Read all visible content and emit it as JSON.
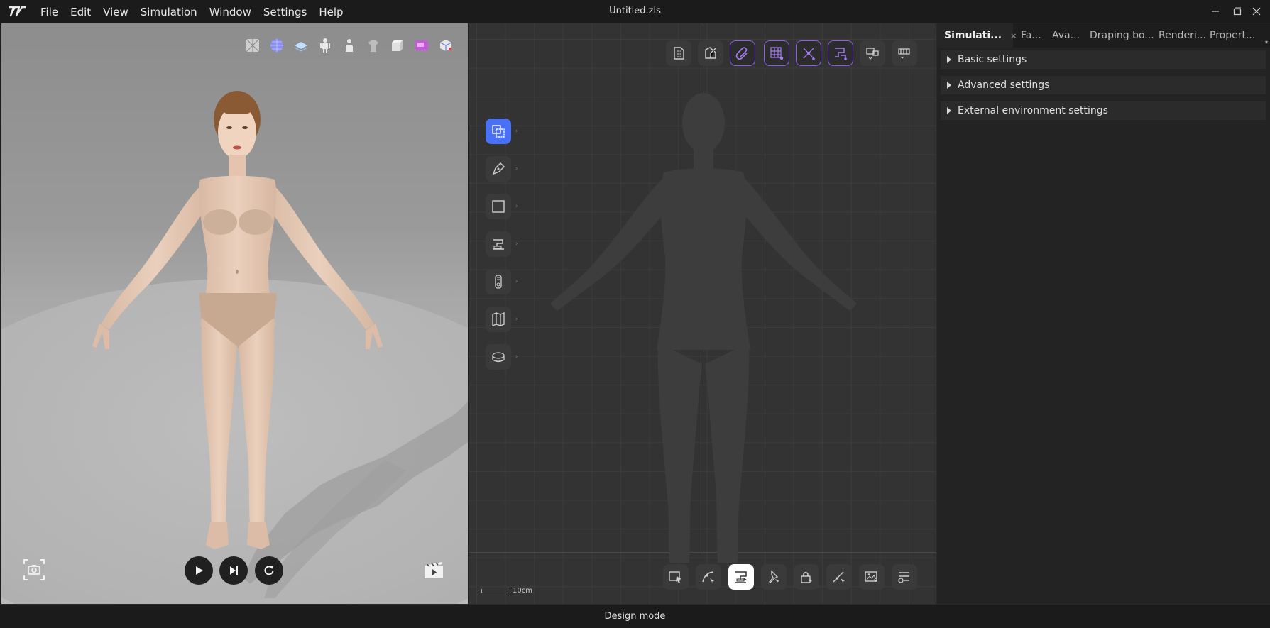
{
  "app": {
    "document_title": "Untitled.zls"
  },
  "menu": {
    "items": [
      "File",
      "Edit",
      "View",
      "Simulation",
      "Window",
      "Settings",
      "Help"
    ]
  },
  "viewport3d": {
    "toolbar_icons": [
      "fabric-texture-icon",
      "mesh-sphere-icon",
      "layer-icon",
      "avatar-icon",
      "avatar-pose-icon",
      "garment-icon",
      "cube-icon",
      "sewing-machine-icon",
      "view-cube-icon"
    ],
    "controls": [
      "camera-icon",
      "play-icon",
      "step-forward-icon",
      "reset-icon",
      "film-icon"
    ]
  },
  "view2d": {
    "top_tools": [
      "pattern-import-icon",
      "pattern-edit-icon",
      "link-icon",
      "grid-select-icon",
      "point-icon",
      "sew-tool-icon",
      "display-toggle-icon",
      "display-mode-icon"
    ],
    "left_tools": [
      "select-transform-icon",
      "pen-icon",
      "rectangle-icon",
      "sewing-icon",
      "zipper-icon",
      "fold-icon",
      "measure-icon"
    ],
    "bottom_tools": [
      "select-icon",
      "curve-edit-icon",
      "sew-display-icon",
      "pin-icon",
      "lock-icon",
      "cut-icon",
      "image-icon",
      "settings-list-icon"
    ],
    "scale_label": "10cm"
  },
  "rightpanel": {
    "tabs": [
      {
        "label": "Simulati..."
      },
      {
        "label": "Fa..."
      },
      {
        "label": "Ava..."
      },
      {
        "label": "Draping bo..."
      },
      {
        "label": "Renderi..."
      },
      {
        "label": "Propert..."
      }
    ],
    "sections": [
      "Basic settings",
      "Advanced settings",
      "External environment settings"
    ]
  },
  "status": {
    "mode": "Design mode"
  },
  "colors": {
    "accent_blue": "#4a70f5",
    "accent_purple": "#8e5cf0",
    "panel_bg": "#232323"
  }
}
